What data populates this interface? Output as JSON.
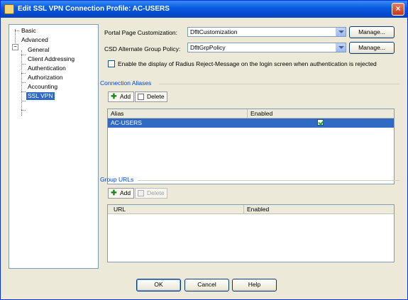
{
  "window": {
    "title": "Edit SSL VPN Connection Profile: AC-USERS",
    "close_label": "×"
  },
  "nav": {
    "expander": "−",
    "items": [
      {
        "label": "Basic"
      },
      {
        "label": "Advanced"
      },
      {
        "label": "General"
      },
      {
        "label": "Client Addressing"
      },
      {
        "label": "Authentication"
      },
      {
        "label": "Authorization"
      },
      {
        "label": "Accounting"
      },
      {
        "label": "SSL VPN",
        "selected": true
      }
    ]
  },
  "form": {
    "portal_label": "Portal Page Customization:",
    "portal_value": "DfltCustomization",
    "csd_label": "CSD Alternate Group Policy:",
    "csd_value": "DfltGrpPolicy",
    "manage_label": "Manage...",
    "radius_checkbox_label": "Enable the display of Radius Reject-Message on the login screen when authentication is rejected",
    "radius_checked": false
  },
  "connection_aliases": {
    "section_title": "Connection Aliases",
    "add_label": "Add",
    "delete_label": "Delete",
    "columns": [
      "Alias",
      "Enabled"
    ],
    "rows": [
      {
        "alias": "AC-USERS",
        "enabled": true
      }
    ]
  },
  "group_urls": {
    "section_title": "Group URLs",
    "add_label": "Add",
    "delete_label": "Delete",
    "columns": [
      "URL",
      "Enabled"
    ],
    "rows": []
  },
  "footer": {
    "ok": "OK",
    "cancel": "Cancel",
    "help": "Help"
  },
  "colors": {
    "accent": "#316ac5",
    "section": "#0046d5",
    "title_bar": "#0a5ee0"
  }
}
